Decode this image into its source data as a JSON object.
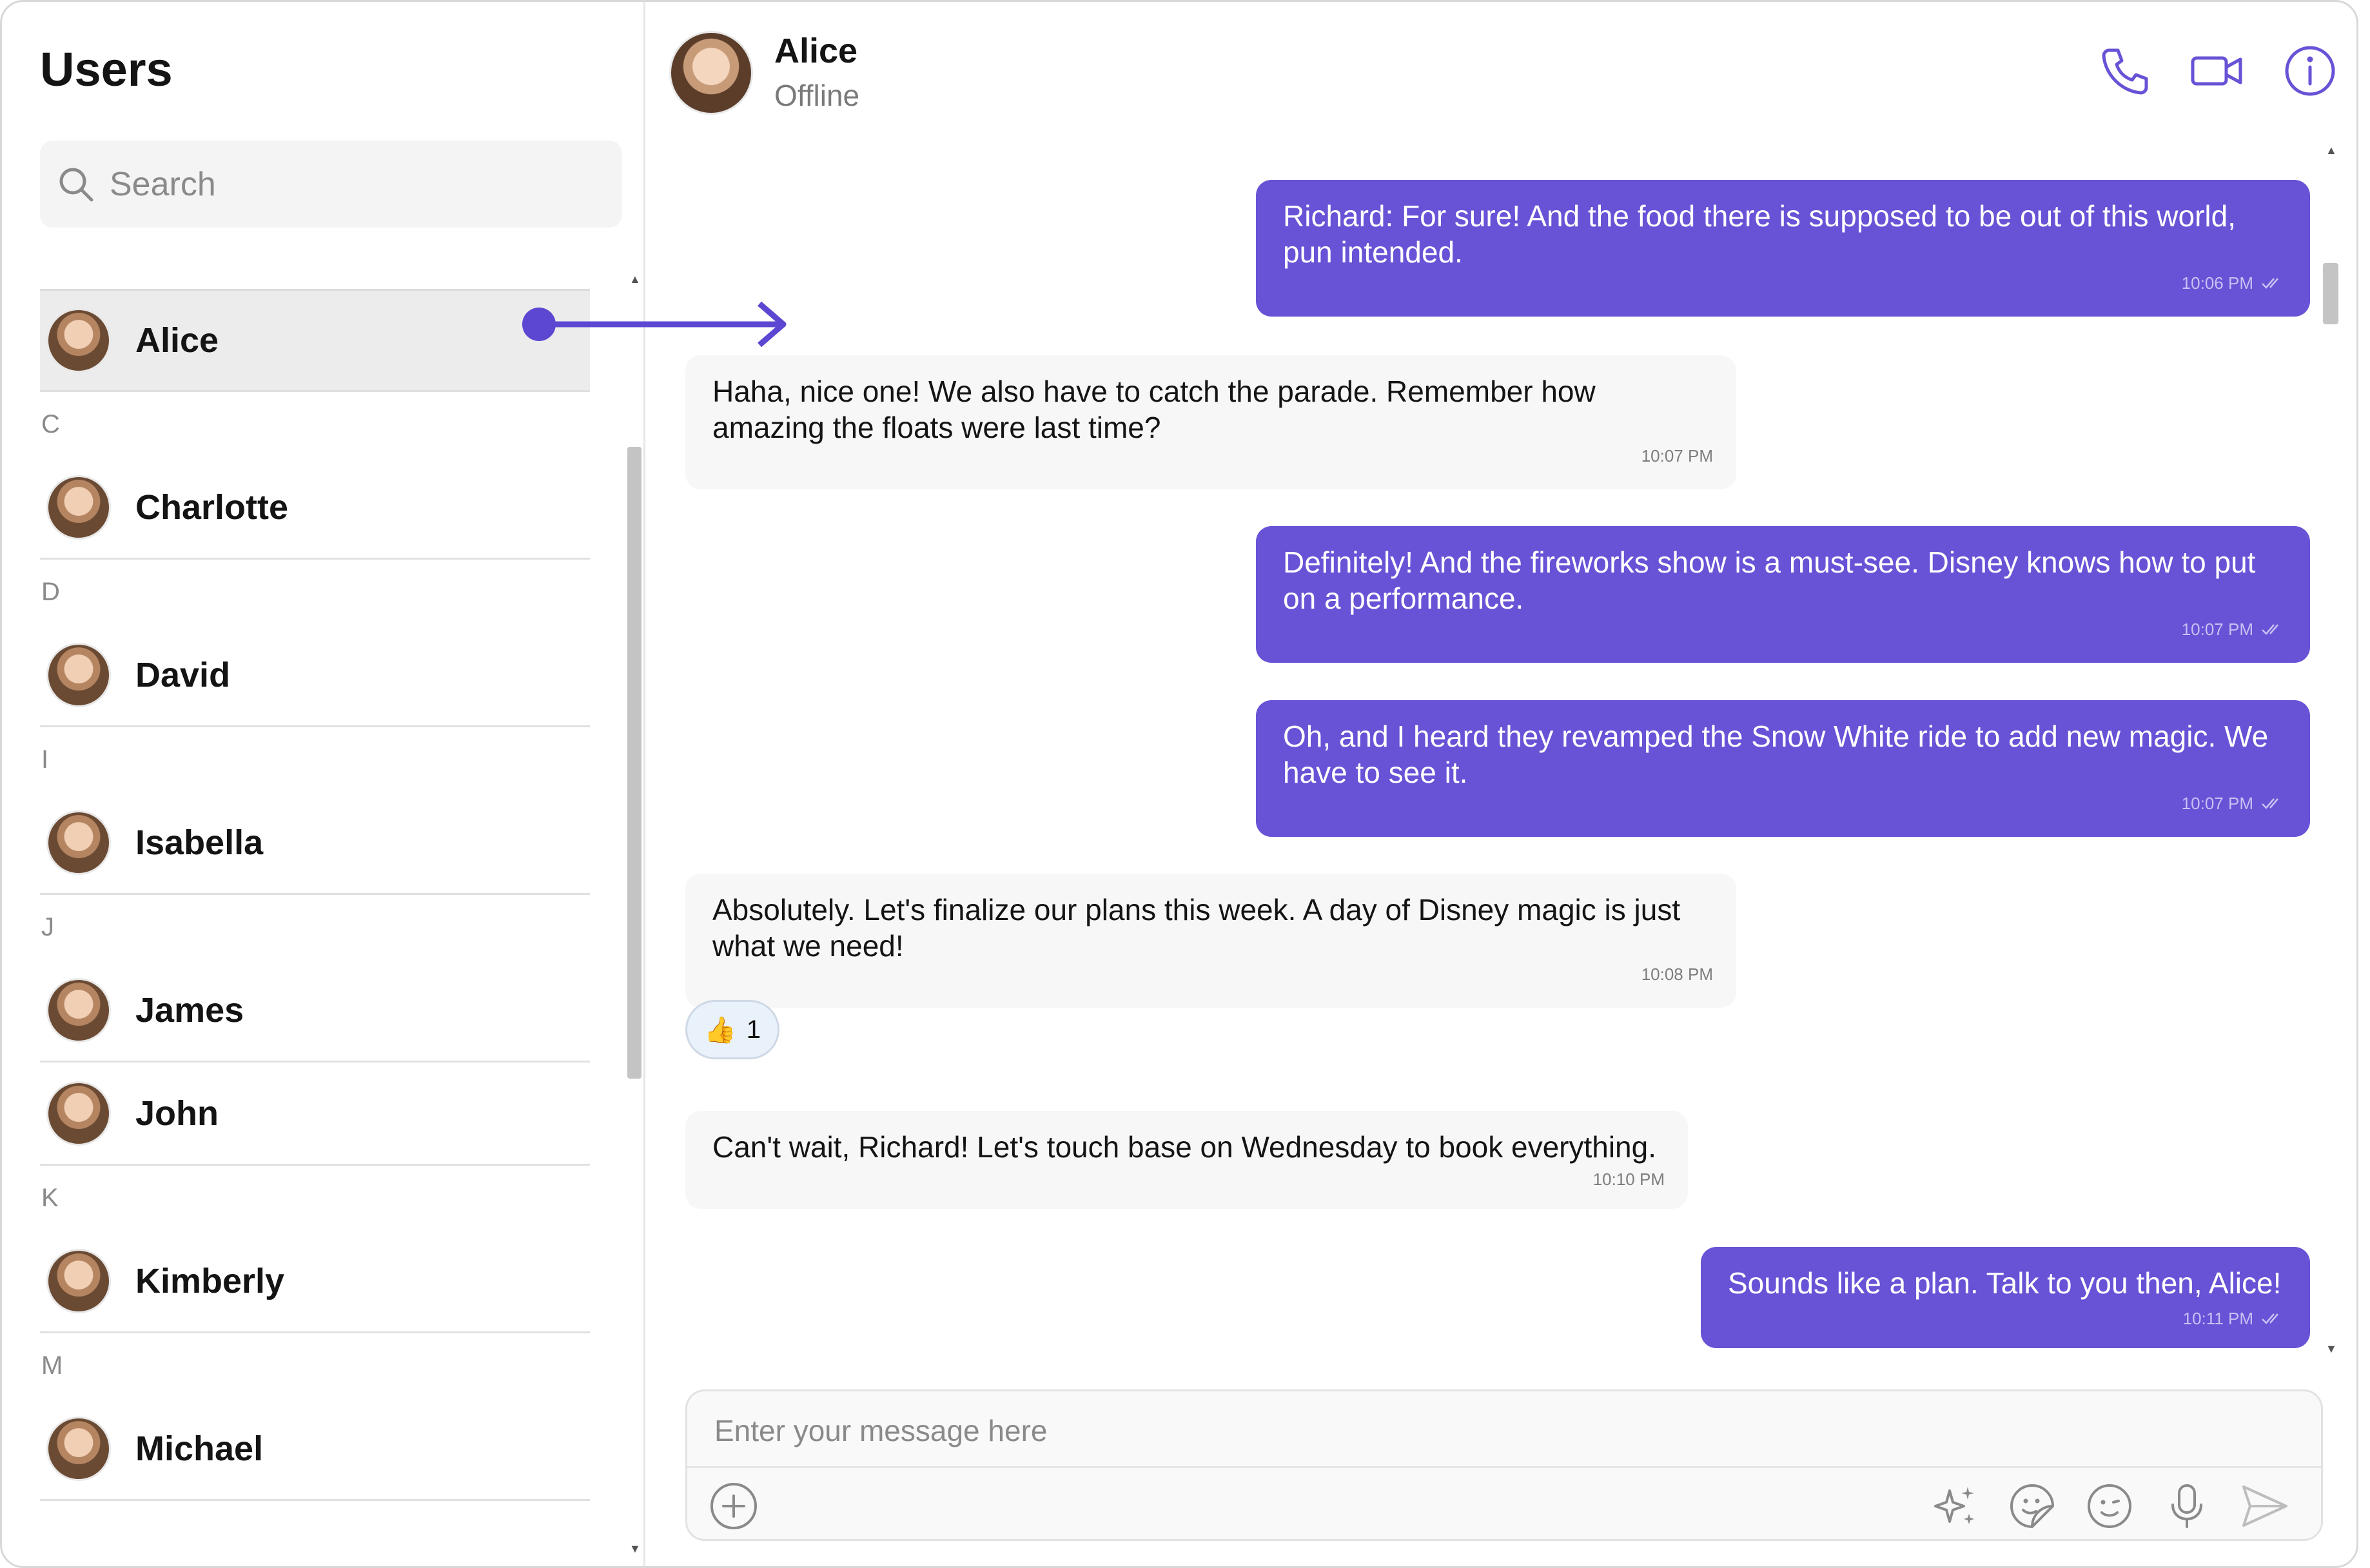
{
  "sidebar": {
    "title": "Users",
    "search_placeholder": "Search",
    "groups": [
      {
        "letter": "",
        "users": [
          "Alice"
        ]
      },
      {
        "letter": "C",
        "users": [
          "Charlotte"
        ]
      },
      {
        "letter": "D",
        "users": [
          "David"
        ]
      },
      {
        "letter": "I",
        "users": [
          "Isabella"
        ]
      },
      {
        "letter": "J",
        "users": [
          "James",
          "John"
        ]
      },
      {
        "letter": "K",
        "users": [
          "Kimberly"
        ]
      },
      {
        "letter": "M",
        "users": [
          "Michael"
        ]
      }
    ],
    "active_user": "Alice"
  },
  "header": {
    "name": "Alice",
    "status": "Offline",
    "icons": [
      "phone-icon",
      "video-icon",
      "info-icon"
    ]
  },
  "messages": [
    {
      "direction": "out",
      "text": "Richard: For sure! And the food there is supposed to be out of this world, pun intended.",
      "time": "10:06 PM",
      "read": true
    },
    {
      "direction": "in",
      "text": "Haha, nice one! We also have to catch the parade. Remember how amazing the floats were last time?",
      "time": "10:07 PM"
    },
    {
      "direction": "out",
      "text": "Definitely! And the fireworks show is a must-see. Disney knows how to put on a performance.",
      "time": "10:07 PM",
      "read": true
    },
    {
      "direction": "out",
      "text": "Oh, and I heard they revamped the Snow White ride to add new magic. We have to see it.",
      "time": "10:07 PM",
      "read": true
    },
    {
      "direction": "in",
      "text": "Absolutely. Let's finalize our plans this week. A day of Disney magic is just what we need!",
      "time": "10:08 PM"
    },
    {
      "direction": "in",
      "text": "Can't wait, Richard! Let's touch base on Wednesday to book everything.",
      "time": "10:10 PM"
    },
    {
      "direction": "out",
      "text": "Sounds like a plan. Talk to you then, Alice!",
      "time": "10:11 PM",
      "read": true
    }
  ],
  "reaction": {
    "emoji": "👍",
    "count": "1"
  },
  "composer": {
    "placeholder": "Enter your message here",
    "icons": [
      "add-icon",
      "ai-sparkle-icon",
      "sticker-icon",
      "emoji-icon",
      "microphone-icon",
      "send-icon"
    ]
  },
  "colors": {
    "accent": "#6852d6",
    "incoming_bubble": "#f7f7f7",
    "muted_text": "#8a8a8a"
  }
}
